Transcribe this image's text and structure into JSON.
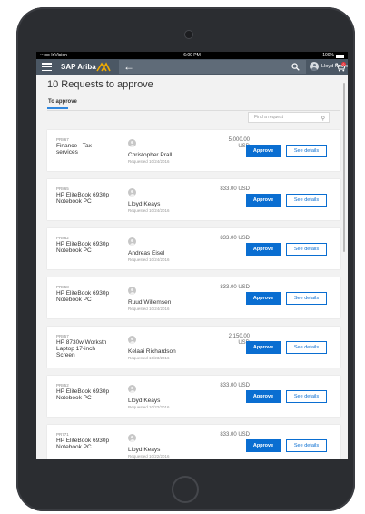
{
  "status_bar": {
    "carrier": "•••oo InVision",
    "time": "6:00 PM",
    "battery": "100%"
  },
  "app_bar": {
    "brand": "SAP Ariba",
    "user_name": "Lloyd Keays",
    "cart_count": "0",
    "colors": {
      "bar": "#4b5764",
      "brand_accent": "#f0ab00"
    }
  },
  "page": {
    "title": "10 Requests to approve",
    "tab_label": "To approve",
    "search_placeholder": "Find a request"
  },
  "buttons": {
    "approve": "Approve",
    "see_details": "See details"
  },
  "requests": [
    {
      "id": "PR867",
      "title": "Finance - Tax services",
      "requester": "Christopher Prall",
      "requested": "Requested 10/24/2016",
      "amount": "5,000.00 USD"
    },
    {
      "id": "PR865",
      "title": "HP EliteBook 6930p Notebook PC",
      "requester": "Lloyd Keays",
      "requested": "Requested 10/24/2016",
      "amount": "833.00 USD"
    },
    {
      "id": "PR862",
      "title": "HP EliteBook 6930p Notebook PC",
      "requester": "Andreas Eisel",
      "requested": "Requested 10/24/2016",
      "amount": "833.00 USD"
    },
    {
      "id": "PR858",
      "title": "HP EliteBook 6930p Notebook PC",
      "requester": "Ruud Willemsen",
      "requested": "Requested 10/24/2016",
      "amount": "833.00 USD"
    },
    {
      "id": "PR857",
      "title": "HP 8730w Workstn Laptop 17-inch Screen",
      "requester": "Kelaai Richardson",
      "requested": "Requested 10/23/2016",
      "amount": "2,150.00 USD"
    },
    {
      "id": "PR852",
      "title": "HP EliteBook 6930p Notebook PC",
      "requester": "Lloyd Keays",
      "requested": "Requested 10/22/2016",
      "amount": "833.00 USD"
    },
    {
      "id": "PR771",
      "title": "HP EliteBook 6930p Notebook PC",
      "requester": "Lloyd Keays",
      "requested": "Requested 10/22/2016",
      "amount": "833.00 USD"
    }
  ]
}
